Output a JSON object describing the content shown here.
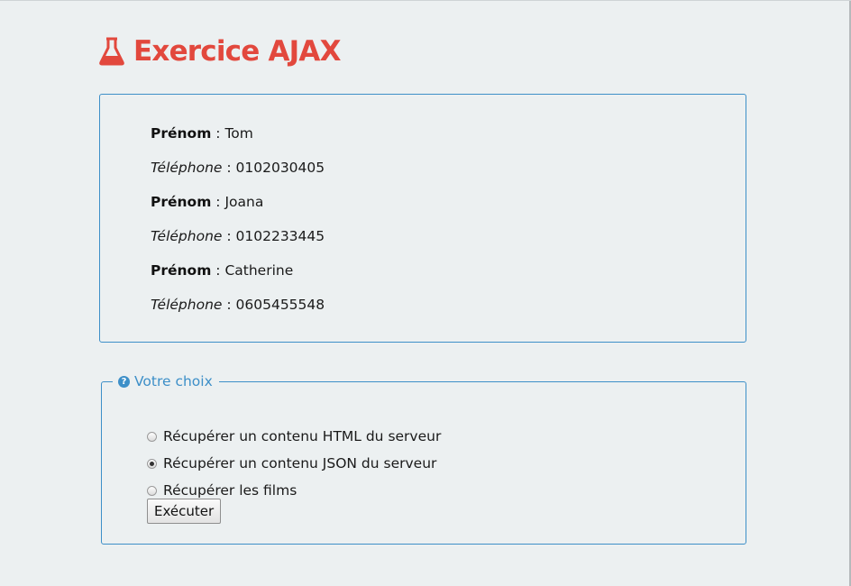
{
  "header": {
    "title": "Exercice AJAX",
    "icon": "flask-icon",
    "color": "#e2483d"
  },
  "results": {
    "persons": [
      {
        "firstname_label": "Prénom",
        "firstname": "Tom",
        "phone_label": "Téléphone",
        "phone": "0102030405"
      },
      {
        "firstname_label": "Prénom",
        "firstname": "Joana",
        "phone_label": "Téléphone",
        "phone": "0102233445"
      },
      {
        "firstname_label": "Prénom",
        "firstname": "Catherine",
        "phone_label": "Téléphone",
        "phone": "0605455548"
      }
    ],
    "separator": " : "
  },
  "choice": {
    "legend": "Votre choix",
    "legend_icon": "question-circle-icon",
    "accent_color": "#3d8fc8",
    "options": [
      {
        "label": "Récupérer un contenu HTML du serveur",
        "checked": false
      },
      {
        "label": "Récupérer un contenu JSON du serveur",
        "checked": true
      },
      {
        "label": "Récupérer les films",
        "checked": false
      }
    ],
    "button_label": "Exécuter"
  }
}
